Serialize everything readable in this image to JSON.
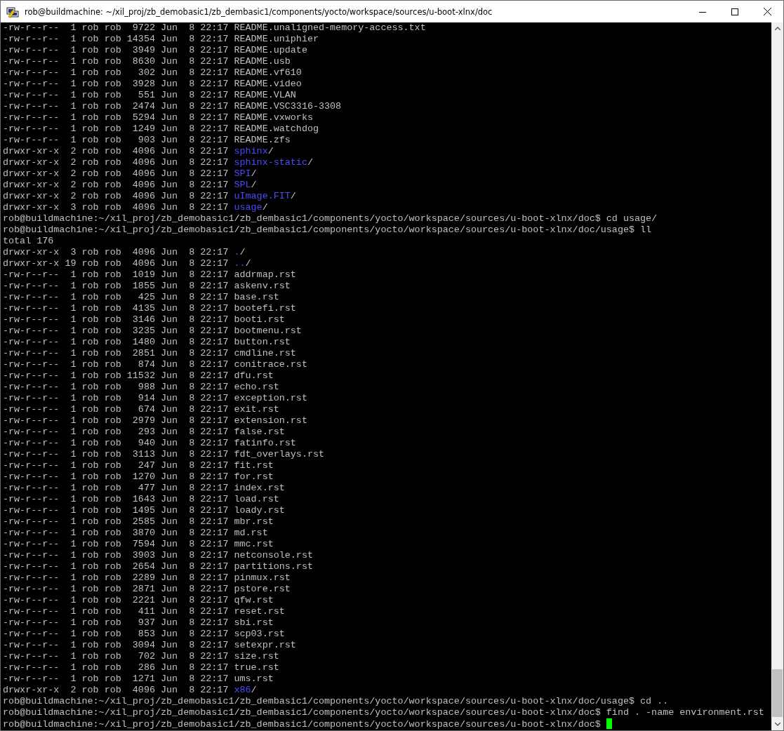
{
  "window": {
    "title": "rob@buildmachine: ~/xil_proj/zb_demobasic1/zb_dembasic1/components/yocto/workspace/sources/u-boot-xlnx/doc"
  },
  "lines": [
    {
      "kind": "file",
      "info": "-rw-r--r--  1 rob rob  9722 Jun  8 22:17",
      "name": "README.unaligned-memory-access.txt"
    },
    {
      "kind": "file",
      "info": "-rw-r--r--  1 rob rob 14354 Jun  8 22:17",
      "name": "README.uniphier"
    },
    {
      "kind": "file",
      "info": "-rw-r--r--  1 rob rob  3949 Jun  8 22:17",
      "name": "README.update"
    },
    {
      "kind": "file",
      "info": "-rw-r--r--  1 rob rob  8630 Jun  8 22:17",
      "name": "README.usb"
    },
    {
      "kind": "file",
      "info": "-rw-r--r--  1 rob rob   302 Jun  8 22:17",
      "name": "README.vf610"
    },
    {
      "kind": "file",
      "info": "-rw-r--r--  1 rob rob  3928 Jun  8 22:17",
      "name": "README.video"
    },
    {
      "kind": "file",
      "info": "-rw-r--r--  1 rob rob   551 Jun  8 22:17",
      "name": "README.VLAN"
    },
    {
      "kind": "file",
      "info": "-rw-r--r--  1 rob rob  2474 Jun  8 22:17",
      "name": "README.VSC3316-3308"
    },
    {
      "kind": "file",
      "info": "-rw-r--r--  1 rob rob  5294 Jun  8 22:17",
      "name": "README.vxworks"
    },
    {
      "kind": "file",
      "info": "-rw-r--r--  1 rob rob  1249 Jun  8 22:17",
      "name": "README.watchdog"
    },
    {
      "kind": "file",
      "info": "-rw-r--r--  1 rob rob   903 Jun  8 22:17",
      "name": "README.zfs"
    },
    {
      "kind": "dir",
      "info": "drwxr-xr-x  2 rob rob  4096 Jun  8 22:17",
      "name": "sphinx",
      "suffix": "/"
    },
    {
      "kind": "dir",
      "info": "drwxr-xr-x  2 rob rob  4096 Jun  8 22:17",
      "name": "sphinx-static",
      "suffix": "/"
    },
    {
      "kind": "dir",
      "info": "drwxr-xr-x  2 rob rob  4096 Jun  8 22:17",
      "name": "SPI",
      "suffix": "/"
    },
    {
      "kind": "dir",
      "info": "drwxr-xr-x  2 rob rob  4096 Jun  8 22:17",
      "name": "SPL",
      "suffix": "/"
    },
    {
      "kind": "dir",
      "info": "drwxr-xr-x  2 rob rob  4096 Jun  8 22:17",
      "name": "uImage.FIT",
      "suffix": "/"
    },
    {
      "kind": "dir",
      "info": "drwxr-xr-x  3 rob rob  4096 Jun  8 22:17",
      "name": "usage",
      "suffix": "/"
    },
    {
      "kind": "prompt",
      "text": "rob@buildmachine:~/xil_proj/zb_demobasic1/zb_dembasic1/components/yocto/workspace/sources/u-boot-xlnx/doc$ cd usage/",
      "cursor": false
    },
    {
      "kind": "prompt",
      "text": "rob@buildmachine:~/xil_proj/zb_demobasic1/zb_dembasic1/components/yocto/workspace/sources/u-boot-xlnx/doc/usage$ ll",
      "cursor": false
    },
    {
      "kind": "output",
      "text": "total 176"
    },
    {
      "kind": "dir",
      "info": "drwxr-xr-x  3 rob rob  4096 Jun  8 22:17",
      "name": ".",
      "suffix": "/"
    },
    {
      "kind": "dir",
      "info": "drwxr-xr-x 19 rob rob  4096 Jun  8 22:17",
      "name": "..",
      "suffix": "/"
    },
    {
      "kind": "file",
      "info": "-rw-r--r--  1 rob rob  1019 Jun  8 22:17",
      "name": "addrmap.rst"
    },
    {
      "kind": "file",
      "info": "-rw-r--r--  1 rob rob  1855 Jun  8 22:17",
      "name": "askenv.rst"
    },
    {
      "kind": "file",
      "info": "-rw-r--r--  1 rob rob   425 Jun  8 22:17",
      "name": "base.rst"
    },
    {
      "kind": "file",
      "info": "-rw-r--r--  1 rob rob  4135 Jun  8 22:17",
      "name": "bootefi.rst"
    },
    {
      "kind": "file",
      "info": "-rw-r--r--  1 rob rob  3146 Jun  8 22:17",
      "name": "booti.rst"
    },
    {
      "kind": "file",
      "info": "-rw-r--r--  1 rob rob  3235 Jun  8 22:17",
      "name": "bootmenu.rst"
    },
    {
      "kind": "file",
      "info": "-rw-r--r--  1 rob rob  1480 Jun  8 22:17",
      "name": "button.rst"
    },
    {
      "kind": "file",
      "info": "-rw-r--r--  1 rob rob  2851 Jun  8 22:17",
      "name": "cmdline.rst"
    },
    {
      "kind": "file",
      "info": "-rw-r--r--  1 rob rob   874 Jun  8 22:17",
      "name": "conitrace.rst"
    },
    {
      "kind": "file",
      "info": "-rw-r--r--  1 rob rob 11532 Jun  8 22:17",
      "name": "dfu.rst"
    },
    {
      "kind": "file",
      "info": "-rw-r--r--  1 rob rob   988 Jun  8 22:17",
      "name": "echo.rst"
    },
    {
      "kind": "file",
      "info": "-rw-r--r--  1 rob rob   914 Jun  8 22:17",
      "name": "exception.rst"
    },
    {
      "kind": "file",
      "info": "-rw-r--r--  1 rob rob   674 Jun  8 22:17",
      "name": "exit.rst"
    },
    {
      "kind": "file",
      "info": "-rw-r--r--  1 rob rob  2979 Jun  8 22:17",
      "name": "extension.rst"
    },
    {
      "kind": "file",
      "info": "-rw-r--r--  1 rob rob   293 Jun  8 22:17",
      "name": "false.rst"
    },
    {
      "kind": "file",
      "info": "-rw-r--r--  1 rob rob   940 Jun  8 22:17",
      "name": "fatinfo.rst"
    },
    {
      "kind": "file",
      "info": "-rw-r--r--  1 rob rob  3113 Jun  8 22:17",
      "name": "fdt_overlays.rst"
    },
    {
      "kind": "file",
      "info": "-rw-r--r--  1 rob rob   247 Jun  8 22:17",
      "name": "fit.rst"
    },
    {
      "kind": "file",
      "info": "-rw-r--r--  1 rob rob  1270 Jun  8 22:17",
      "name": "for.rst"
    },
    {
      "kind": "file",
      "info": "-rw-r--r--  1 rob rob   477 Jun  8 22:17",
      "name": "index.rst"
    },
    {
      "kind": "file",
      "info": "-rw-r--r--  1 rob rob  1643 Jun  8 22:17",
      "name": "load.rst"
    },
    {
      "kind": "file",
      "info": "-rw-r--r--  1 rob rob  1495 Jun  8 22:17",
      "name": "loady.rst"
    },
    {
      "kind": "file",
      "info": "-rw-r--r--  1 rob rob  2585 Jun  8 22:17",
      "name": "mbr.rst"
    },
    {
      "kind": "file",
      "info": "-rw-r--r--  1 rob rob  3870 Jun  8 22:17",
      "name": "md.rst"
    },
    {
      "kind": "file",
      "info": "-rw-r--r--  1 rob rob  7594 Jun  8 22:17",
      "name": "mmc.rst"
    },
    {
      "kind": "file",
      "info": "-rw-r--r--  1 rob rob  3903 Jun  8 22:17",
      "name": "netconsole.rst"
    },
    {
      "kind": "file",
      "info": "-rw-r--r--  1 rob rob  2654 Jun  8 22:17",
      "name": "partitions.rst"
    },
    {
      "kind": "file",
      "info": "-rw-r--r--  1 rob rob  2289 Jun  8 22:17",
      "name": "pinmux.rst"
    },
    {
      "kind": "file",
      "info": "-rw-r--r--  1 rob rob  2871 Jun  8 22:17",
      "name": "pstore.rst"
    },
    {
      "kind": "file",
      "info": "-rw-r--r--  1 rob rob  2221 Jun  8 22:17",
      "name": "qfw.rst"
    },
    {
      "kind": "file",
      "info": "-rw-r--r--  1 rob rob   411 Jun  8 22:17",
      "name": "reset.rst"
    },
    {
      "kind": "file",
      "info": "-rw-r--r--  1 rob rob   937 Jun  8 22:17",
      "name": "sbi.rst"
    },
    {
      "kind": "file",
      "info": "-rw-r--r--  1 rob rob   853 Jun  8 22:17",
      "name": "scp03.rst"
    },
    {
      "kind": "file",
      "info": "-rw-r--r--  1 rob rob  3094 Jun  8 22:17",
      "name": "setexpr.rst"
    },
    {
      "kind": "file",
      "info": "-rw-r--r--  1 rob rob   702 Jun  8 22:17",
      "name": "size.rst"
    },
    {
      "kind": "file",
      "info": "-rw-r--r--  1 rob rob   286 Jun  8 22:17",
      "name": "true.rst"
    },
    {
      "kind": "file",
      "info": "-rw-r--r--  1 rob rob  1271 Jun  8 22:17",
      "name": "ums.rst"
    },
    {
      "kind": "dir",
      "info": "drwxr-xr-x  2 rob rob  4096 Jun  8 22:17",
      "name": "x86",
      "suffix": "/"
    },
    {
      "kind": "prompt",
      "text": "rob@buildmachine:~/xil_proj/zb_demobasic1/zb_dembasic1/components/yocto/workspace/sources/u-boot-xlnx/doc/usage$ cd ..",
      "cursor": false
    },
    {
      "kind": "prompt",
      "text": "rob@buildmachine:~/xil_proj/zb_demobasic1/zb_dembasic1/components/yocto/workspace/sources/u-boot-xlnx/doc$ find . -name environment.rst",
      "cursor": false
    },
    {
      "kind": "prompt",
      "text": "rob@buildmachine:~/xil_proj/zb_demobasic1/zb_dembasic1/components/yocto/workspace/sources/u-boot-xlnx/doc$ ",
      "cursor": true
    }
  ]
}
